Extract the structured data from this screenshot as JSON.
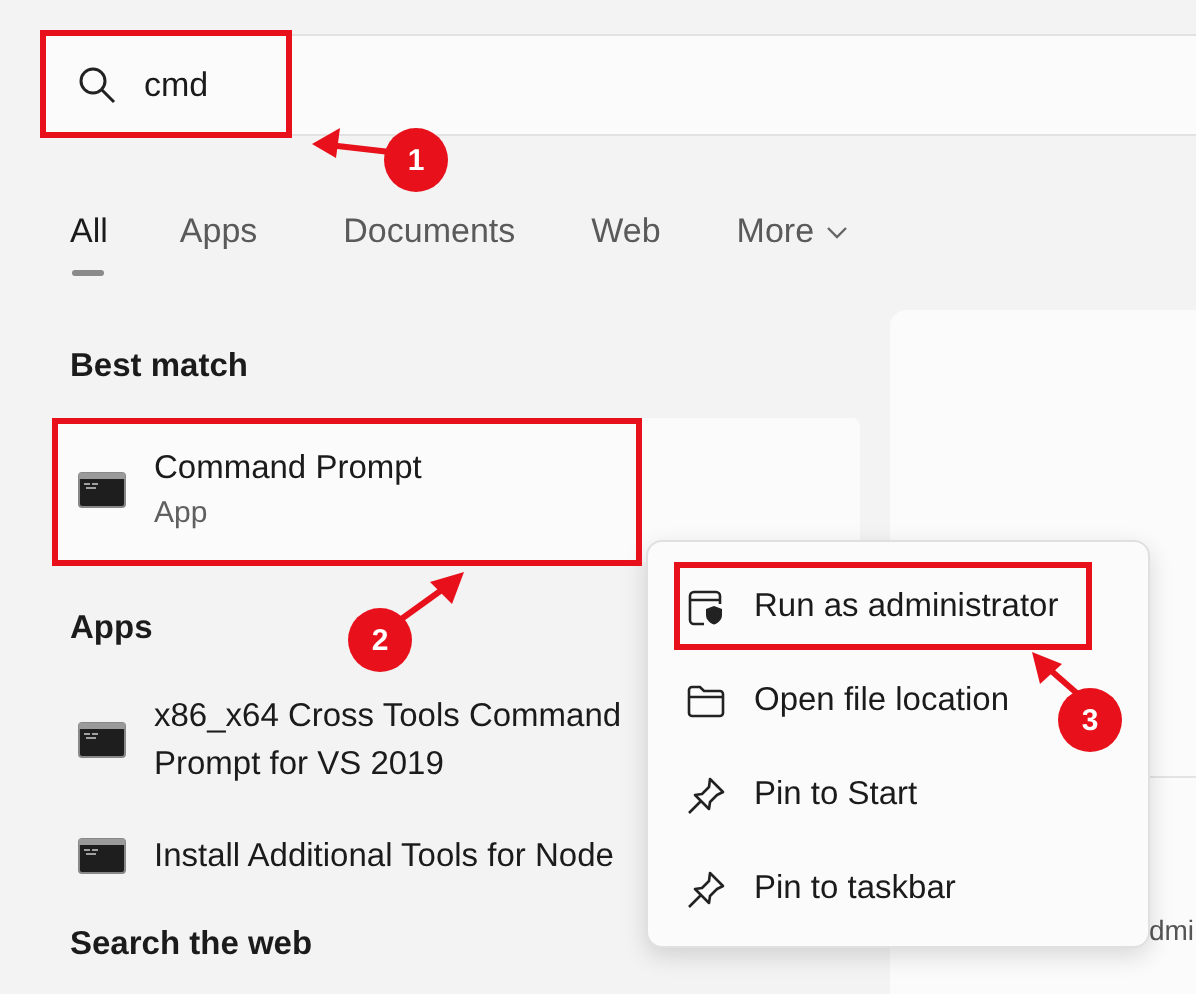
{
  "search": {
    "value": "cmd"
  },
  "tabs": [
    {
      "label": "All",
      "selected": true,
      "kind": "plain"
    },
    {
      "label": "Apps",
      "selected": false,
      "kind": "plain"
    },
    {
      "label": "Documents",
      "selected": false,
      "kind": "plain"
    },
    {
      "label": "Web",
      "selected": false,
      "kind": "plain"
    },
    {
      "label": "More",
      "selected": false,
      "kind": "dropdown"
    }
  ],
  "best_match": {
    "heading": "Best match",
    "items": [
      {
        "title": "Command Prompt",
        "subtitle": "App"
      }
    ]
  },
  "apps": {
    "heading": "Apps",
    "items": [
      {
        "title": "x86_x64 Cross Tools Command Prompt for VS 2019"
      },
      {
        "title": "Install Additional Tools for Node"
      }
    ]
  },
  "search_web": {
    "heading": "Search the web"
  },
  "right_panel": {
    "texts": [
      "dmi"
    ]
  },
  "context_menu": {
    "items": [
      {
        "label": "Run as administrator",
        "kind": "admin"
      },
      {
        "label": "Open file location",
        "kind": "folder"
      },
      {
        "label": "Pin to Start",
        "kind": "pin"
      },
      {
        "label": "Pin to taskbar",
        "kind": "pin"
      }
    ]
  },
  "annotations": [
    {
      "label": "1"
    },
    {
      "label": "2"
    },
    {
      "label": "3"
    }
  ]
}
